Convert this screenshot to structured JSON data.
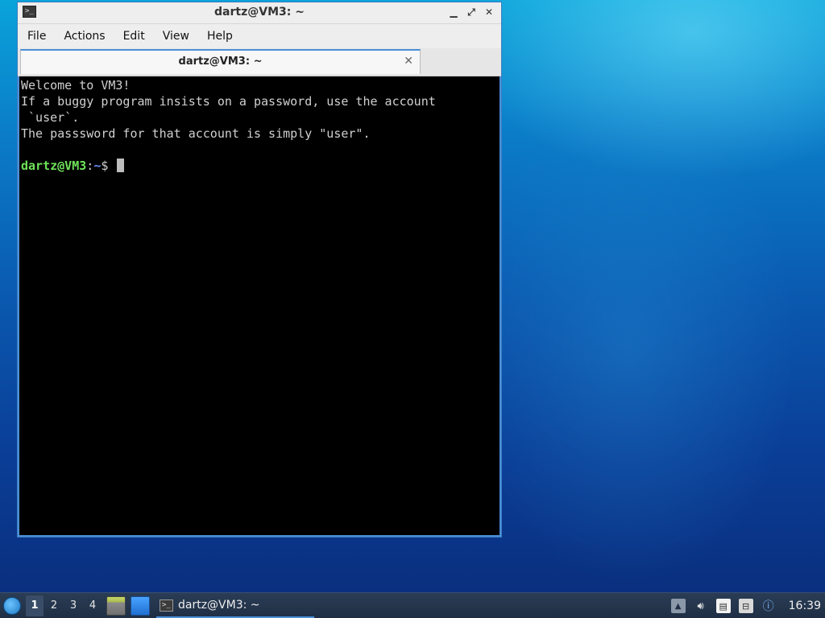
{
  "window": {
    "title": "dartz@VM3: ~",
    "icon": "terminal-icon",
    "buttons": {
      "minimize": "▁",
      "maximize": "⤢",
      "close": "✕"
    }
  },
  "menu": {
    "items": [
      {
        "label": "File"
      },
      {
        "label": "Actions"
      },
      {
        "label": "Edit"
      },
      {
        "label": "View"
      },
      {
        "label": "Help"
      }
    ]
  },
  "tab": {
    "label": "dartz@VM3: ~",
    "close": "✕"
  },
  "terminal": {
    "lines": [
      "Welcome to VM3!",
      "If a buggy program insists on a password, use the account",
      " `user`.",
      "The passsword for that account is simply \"user\".",
      ""
    ],
    "prompt_user": "dartz@VM3",
    "prompt_sep": ":",
    "prompt_path": "~",
    "prompt_symbol": "$ "
  },
  "taskbar": {
    "workspaces": [
      "1",
      "2",
      "3",
      "4"
    ],
    "active_workspace": "1",
    "task_label": "dartz@VM3: ~",
    "clock": "16:39",
    "tray_icons": [
      "up-arrow-icon",
      "volume-icon",
      "clipboard-icon",
      "network-icon",
      "update-notifier-icon"
    ]
  }
}
